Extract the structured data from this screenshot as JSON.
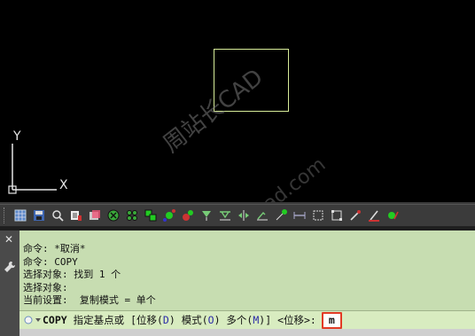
{
  "canvas": {
    "ucs": {
      "x_label": "X",
      "y_label": "Y"
    },
    "watermark": {
      "line1": "周站长CAD",
      "line2": "zzcad.com"
    },
    "colors": {
      "background": "#000000",
      "rect_stroke": "#d8ee9a",
      "ucs_stroke": "#e6e6e6"
    }
  },
  "toolbar": {
    "buttons": [
      "grid-icon",
      "save-icon",
      "find-icon",
      "matchprop-icon",
      "layer-icon",
      "object-snap-icon",
      "snap-grid-icon",
      "move-icon",
      "rotate-icon",
      "trim-icon",
      "extend-icon",
      "stretch-icon",
      "mirror-icon",
      "fillet-icon",
      "measure-icon",
      "distance-icon",
      "select-area-icon",
      "block-icon",
      "pen-icon",
      "offset-icon",
      "check-icon"
    ]
  },
  "command_panel": {
    "side": {
      "close_glyph": "✕"
    },
    "history": [
      "命令: *取消*",
      "命令: COPY",
      "选择对象: 找到 1 个",
      "选择对象:",
      "当前设置:  复制模式 = 单个"
    ],
    "prompt": {
      "command": "COPY",
      "text": "指定基点或 [位移(",
      "opt_d": "D",
      "mid1": ") 模式(",
      "opt_o": "O",
      "mid2": ") 多个(",
      "opt_m": "M",
      "tail": ")] <位移>:",
      "input_value": "m"
    },
    "colors": {
      "panel": "#c7ddb1",
      "input_highlight": "#e23b24",
      "option_letter": "#2a2aa8"
    }
  }
}
